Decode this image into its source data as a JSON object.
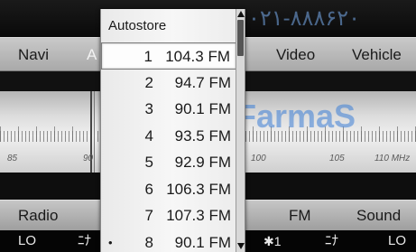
{
  "main_menu": {
    "items": [
      "Navi",
      "A",
      "Video",
      "Vehicle"
    ]
  },
  "tuner": {
    "scale_labels": [
      "85",
      "90",
      "100",
      "105",
      "110 MHz"
    ]
  },
  "function_bar": {
    "items": [
      "Radio",
      "FM",
      "Sound"
    ]
  },
  "status_bar": {
    "left_temp": "LO",
    "left_fan": "ﾆﾅ",
    "seat": "✱1",
    "right_fan": "ﾆﾅ",
    "right_temp": "LO"
  },
  "watermarks": {
    "top": "۰۲۱-۸۸۸۶۲۰",
    "mid": "FarmaS"
  },
  "autostore": {
    "title": "Autostore",
    "stations": [
      {
        "num": "1",
        "freq": "104.3 FM",
        "selected": true,
        "bullet": ""
      },
      {
        "num": "2",
        "freq": "94.7 FM",
        "selected": false,
        "bullet": ""
      },
      {
        "num": "3",
        "freq": "90.1 FM",
        "selected": false,
        "bullet": ""
      },
      {
        "num": "4",
        "freq": "93.5 FM",
        "selected": false,
        "bullet": ""
      },
      {
        "num": "5",
        "freq": "92.9 FM",
        "selected": false,
        "bullet": ""
      },
      {
        "num": "6",
        "freq": "106.3 FM",
        "selected": false,
        "bullet": ""
      },
      {
        "num": "7",
        "freq": "107.3 FM",
        "selected": false,
        "bullet": ""
      },
      {
        "num": "8",
        "freq": "90.1 FM",
        "selected": false,
        "bullet": "•"
      }
    ]
  }
}
